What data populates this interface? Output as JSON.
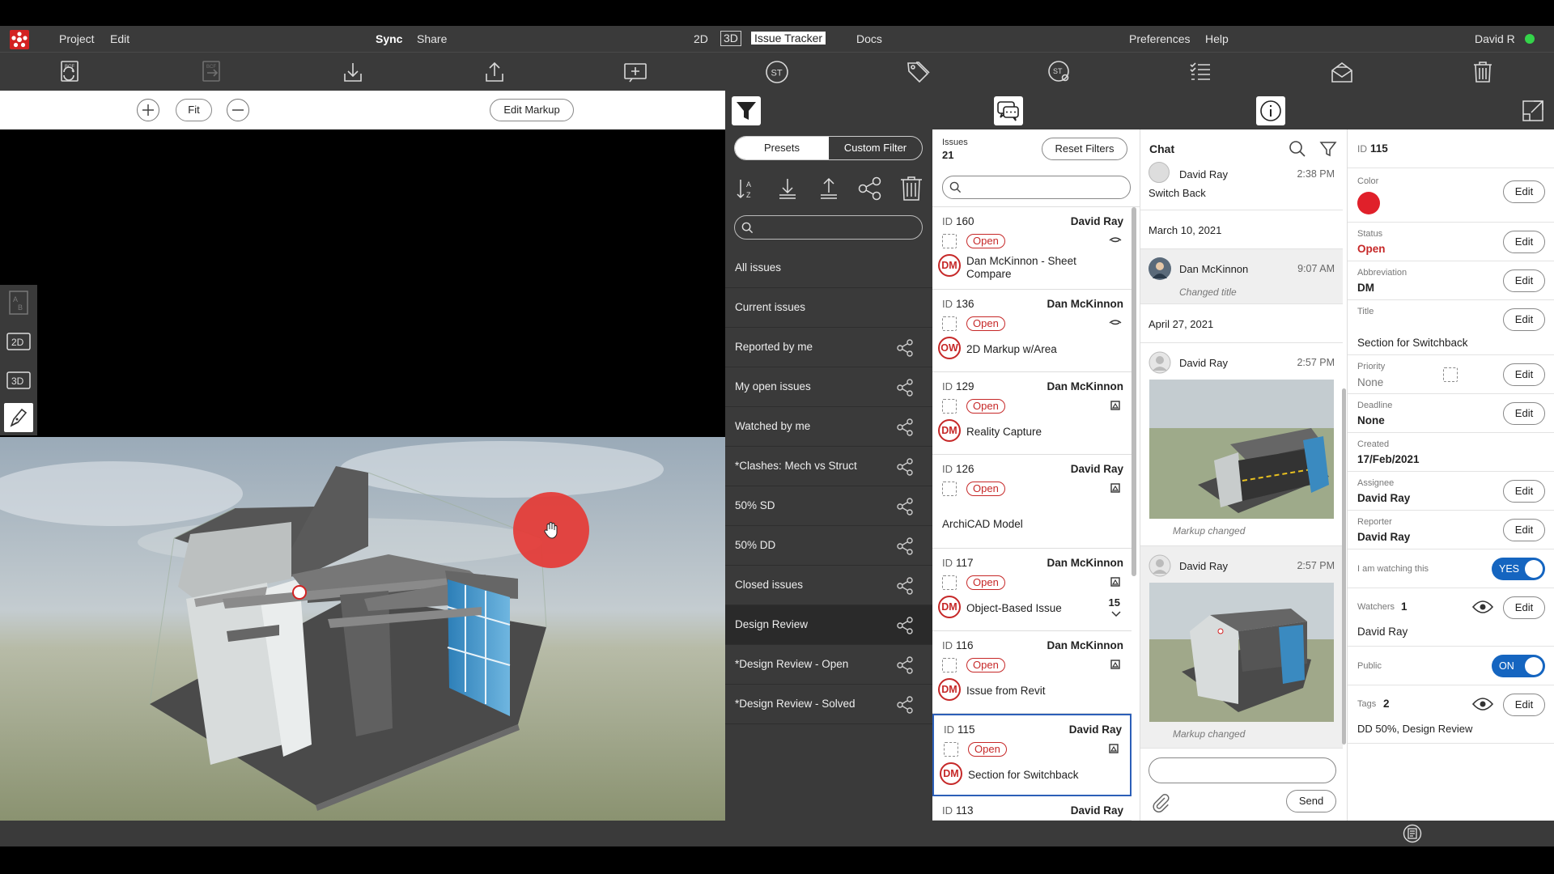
{
  "menubar": {
    "project": "Project",
    "edit": "Edit",
    "sync": "Sync",
    "share": "Share",
    "mode_2d": "2D",
    "mode_3d": "3D",
    "issue_tracker": "Issue Tracker",
    "docs": "Docs",
    "preferences": "Preferences",
    "help": "Help",
    "user": "David R",
    "status_color": "#34d44a"
  },
  "viewer": {
    "fit_label": "Fit",
    "edit_markup_label": "Edit Markup",
    "side_tools": [
      "2D",
      "3D"
    ]
  },
  "filters": {
    "presets_label": "Presets",
    "custom_filter_label": "Custom Filter",
    "search_placeholder": "",
    "items": [
      "All issues",
      "Current issues",
      "Reported by me",
      "My open issues",
      "Watched by me",
      "*Clashes: Mech vs Struct",
      "50% SD",
      "50% DD",
      "Closed issues",
      "Design Review",
      "*Design Review - Open",
      "*Design Review - Solved"
    ]
  },
  "issues": {
    "label": "Issues",
    "count": "21",
    "reset_label": "Reset Filters",
    "search_placeholder": "",
    "cards": [
      {
        "id_label": "ID",
        "id": "160",
        "reporter": "David Ray",
        "status": "Open",
        "avatar": "DM",
        "title": "Dan McKinnon - Sheet Compare"
      },
      {
        "id_label": "ID",
        "id": "136",
        "reporter": "Dan McKinnon",
        "status": "Open",
        "avatar": "OW",
        "title": "2D Markup w/Area"
      },
      {
        "id_label": "ID",
        "id": "129",
        "reporter": "Dan McKinnon",
        "status": "Open",
        "avatar": "DM",
        "title": "Reality Capture"
      },
      {
        "id_label": "ID",
        "id": "126",
        "reporter": "David Ray",
        "status": "Open",
        "avatar": "",
        "title": "ArchiCAD Model"
      },
      {
        "id_label": "ID",
        "id": "117",
        "reporter": "Dan McKinnon",
        "status": "Open",
        "avatar": "DM",
        "title": "Object-Based Issue",
        "count": "15"
      },
      {
        "id_label": "ID",
        "id": "116",
        "reporter": "Dan McKinnon",
        "status": "Open",
        "avatar": "DM",
        "title": "Issue from Revit"
      },
      {
        "id_label": "ID",
        "id": "115",
        "reporter": "David Ray",
        "status": "Open",
        "avatar": "DM",
        "title": "Section for Switchback"
      },
      {
        "id_label": "ID",
        "id": "113",
        "reporter": "David Ray",
        "status": "",
        "avatar": "",
        "title": ""
      }
    ]
  },
  "chat": {
    "title": "Chat",
    "entries": [
      {
        "author": "David Ray",
        "time": "2:38 PM",
        "text": "Switch Back"
      },
      {
        "date": "March 10, 2021"
      },
      {
        "author": "Dan McKinnon",
        "time": "9:07 AM",
        "text": "Changed title"
      },
      {
        "date": "April 27, 2021"
      },
      {
        "author": "David Ray",
        "time": "2:57 PM",
        "text": "Markup changed"
      },
      {
        "author": "David Ray",
        "time": "2:57 PM",
        "text": "Markup changed"
      }
    ],
    "send_label": "Send"
  },
  "details": {
    "id_label": "ID",
    "id": "115",
    "edit_label": "Edit",
    "color_label": "Color",
    "color": "#e0202a",
    "status_label": "Status",
    "status": "Open",
    "abbreviation_label": "Abbreviation",
    "abbreviation": "DM",
    "title_label": "Title",
    "title": "Section for Switchback",
    "priority_label": "Priority",
    "priority": "None",
    "deadline_label": "Deadline",
    "deadline": "None",
    "created_label": "Created",
    "created": "17/Feb/2021",
    "assignee_label": "Assignee",
    "assignee": "David Ray",
    "reporter_label": "Reporter",
    "reporter": "David Ray",
    "watching_label": "I am watching this",
    "watching_value": "YES",
    "watchers_label": "Watchers",
    "watchers_count": "1",
    "watchers": "David Ray",
    "public_label": "Public",
    "public_value": "ON",
    "tags_label": "Tags",
    "tags_count": "2",
    "tags": "DD 50%, Design Review"
  },
  "icons": {
    "toolbar": [
      "bcf-sync-icon",
      "bcf-export-icon",
      "download-icon",
      "upload-icon",
      "add-issue-icon",
      "st-icon",
      "tag-icon",
      "st-settings-icon",
      "checklist-icon",
      "mail-icon",
      "trash-icon"
    ]
  }
}
